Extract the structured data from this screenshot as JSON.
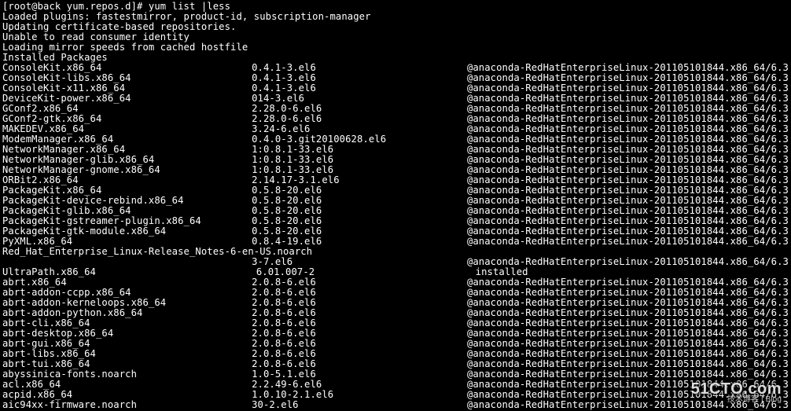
{
  "prompt": "[root@back yum.repos.d]# yum list |less",
  "header_lines": [
    "Loaded plugins: fastestmirror, product-id, subscription-manager",
    "Updating certificate-based repositories.",
    "Unable to read consumer identity",
    "Loading mirror speeds from cached hostfile",
    "Installed Packages"
  ],
  "repo_default": "@anaconda-RedHatEnterpriseLinux-201105101844.x86_64/6.3",
  "packages": [
    {
      "name": "ConsoleKit.x86_64",
      "version": "0.4.1-3.el6",
      "repo": "@anaconda-RedHatEnterpriseLinux-201105101844.x86_64/6.3"
    },
    {
      "name": "ConsoleKit-libs.x86_64",
      "version": "0.4.1-3.el6",
      "repo": "@anaconda-RedHatEnterpriseLinux-201105101844.x86_64/6.3"
    },
    {
      "name": "ConsoleKit-x11.x86_64",
      "version": "0.4.1-3.el6",
      "repo": "@anaconda-RedHatEnterpriseLinux-201105101844.x86_64/6.3"
    },
    {
      "name": "DeviceKit-power.x86_64",
      "version": "014-3.el6",
      "repo": "@anaconda-RedHatEnterpriseLinux-201105101844.x86_64/6.3"
    },
    {
      "name": "GConf2.x86_64",
      "version": "2.28.0-6.el6",
      "repo": "@anaconda-RedHatEnterpriseLinux-201105101844.x86_64/6.3"
    },
    {
      "name": "GConf2-gtk.x86_64",
      "version": "2.28.0-6.el6",
      "repo": "@anaconda-RedHatEnterpriseLinux-201105101844.x86_64/6.3"
    },
    {
      "name": "MAKEDEV.x86_64",
      "version": "3.24-6.el6",
      "repo": "@anaconda-RedHatEnterpriseLinux-201105101844.x86_64/6.3"
    },
    {
      "name": "ModemManager.x86_64",
      "version": "0.4.0-3.git20100628.el6",
      "repo": "@anaconda-RedHatEnterpriseLinux-201105101844.x86_64/6.3"
    },
    {
      "name": "NetworkManager.x86_64",
      "version": "1:0.8.1-33.el6",
      "repo": "@anaconda-RedHatEnterpriseLinux-201105101844.x86_64/6.3"
    },
    {
      "name": "NetworkManager-glib.x86_64",
      "version": "1:0.8.1-33.el6",
      "repo": "@anaconda-RedHatEnterpriseLinux-201105101844.x86_64/6.3"
    },
    {
      "name": "NetworkManager-gnome.x86_64",
      "version": "1:0.8.1-33.el6",
      "repo": "@anaconda-RedHatEnterpriseLinux-201105101844.x86_64/6.3"
    },
    {
      "name": "ORBit2.x86_64",
      "version": "2.14.17-3.1.el6",
      "repo": "@anaconda-RedHatEnterpriseLinux-201105101844.x86_64/6.3"
    },
    {
      "name": "PackageKit.x86_64",
      "version": "0.5.8-20.el6",
      "repo": "@anaconda-RedHatEnterpriseLinux-201105101844.x86_64/6.3"
    },
    {
      "name": "PackageKit-device-rebind.x86_64",
      "version": "0.5.8-20.el6",
      "repo": "@anaconda-RedHatEnterpriseLinux-201105101844.x86_64/6.3"
    },
    {
      "name": "PackageKit-glib.x86_64",
      "version": "0.5.8-20.el6",
      "repo": "@anaconda-RedHatEnterpriseLinux-201105101844.x86_64/6.3"
    },
    {
      "name": "PackageKit-gstreamer-plugin.x86_64",
      "version": "0.5.8-20.el6",
      "repo": "@anaconda-RedHatEnterpriseLinux-201105101844.x86_64/6.3"
    },
    {
      "name": "PackageKit-gtk-module.x86_64",
      "version": "0.5.8-20.el6",
      "repo": "@anaconda-RedHatEnterpriseLinux-201105101844.x86_64/6.3"
    },
    {
      "name": "PyXML.x86_64",
      "version": "0.8.4-19.el6",
      "repo": "@anaconda-RedHatEnterpriseLinux-201105101844.x86_64/6.3"
    },
    {
      "name": "Red_Hat_Enterprise_Linux-Release_Notes-6-en-US.noarch",
      "version": "",
      "repo": ""
    },
    {
      "name": "",
      "version": "3-7.el6",
      "repo": "@anaconda-RedHatEnterpriseLinux-201105101844.x86_64/6.3"
    },
    {
      "name": "UltraPath.x86_64",
      "version": "6.01.007-2",
      "repo": "installed"
    },
    {
      "name": "abrt.x86_64",
      "version": "2.0.8-6.el6",
      "repo": "@anaconda-RedHatEnterpriseLinux-201105101844.x86_64/6.3"
    },
    {
      "name": "abrt-addon-ccpp.x86_64",
      "version": "2.0.8-6.el6",
      "repo": "@anaconda-RedHatEnterpriseLinux-201105101844.x86_64/6.3"
    },
    {
      "name": "abrt-addon-kerneloops.x86_64",
      "version": "2.0.8-6.el6",
      "repo": "@anaconda-RedHatEnterpriseLinux-201105101844.x86_64/6.3"
    },
    {
      "name": "abrt-addon-python.x86_64",
      "version": "2.0.8-6.el6",
      "repo": "@anaconda-RedHatEnterpriseLinux-201105101844.x86_64/6.3"
    },
    {
      "name": "abrt-cli.x86_64",
      "version": "2.0.8-6.el6",
      "repo": "@anaconda-RedHatEnterpriseLinux-201105101844.x86_64/6.3"
    },
    {
      "name": "abrt-desktop.x86_64",
      "version": "2.0.8-6.el6",
      "repo": "@anaconda-RedHatEnterpriseLinux-201105101844.x86_64/6.3"
    },
    {
      "name": "abrt-gui.x86_64",
      "version": "2.0.8-6.el6",
      "repo": "@anaconda-RedHatEnterpriseLinux-201105101844.x86_64/6.3"
    },
    {
      "name": "abrt-libs.x86_64",
      "version": "2.0.8-6.el6",
      "repo": "@anaconda-RedHatEnterpriseLinux-201105101844.x86_64/6.3"
    },
    {
      "name": "abrt-tui.x86_64",
      "version": "2.0.8-6.el6",
      "repo": "@anaconda-RedHatEnterpriseLinux-201105101844.x86_64/6.3"
    },
    {
      "name": "abyssinica-fonts.noarch",
      "version": "1.0-5.1.el6",
      "repo": "@anaconda-RedHatEnterpriseLinux-201105101844.x86_64/6.3"
    },
    {
      "name": "acl.x86_64",
      "version": "2.2.49-6.el6",
      "repo": "@anaconda-RedHatEnterpriseLinux-201105101844.x86_64/6.3"
    },
    {
      "name": "acpid.x86_64",
      "version": "1.0.10-2.1.el6",
      "repo": "@anaconda-RedHatEnterpriseLinux-201105101844.x86_64/6.3"
    },
    {
      "name": "aic94xx-firmware.noarch",
      "version": "30-2.el6",
      "repo": "@anaconda-RedHatEnterpriseLinux-201105101844.x86_64/6.3"
    }
  ],
  "watermark": {
    "brand": "51CTO.com",
    "sub": "技术博客 | Blog"
  }
}
